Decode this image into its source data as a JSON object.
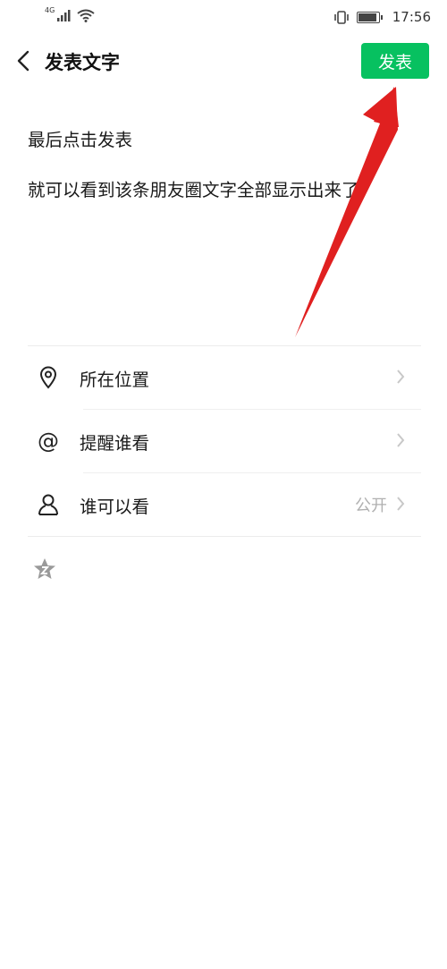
{
  "status_bar": {
    "network_type": "4G",
    "time": "17:56"
  },
  "nav": {
    "title": "发表文字",
    "publish_label": "发表"
  },
  "post": {
    "line1": "最后点击发表",
    "line2": "就可以看到该条朋友圈文字全部显示出来了"
  },
  "options": [
    {
      "label": "所在位置",
      "value": "",
      "icon": "location-pin-icon"
    },
    {
      "label": "提醒谁看",
      "value": "",
      "icon": "at-sign-icon"
    },
    {
      "label": "谁可以看",
      "value": "公开",
      "icon": "person-icon"
    }
  ],
  "colors": {
    "accent": "#07c160",
    "annotation_arrow": "#e02020",
    "secondary_text": "#b0b0b0"
  }
}
